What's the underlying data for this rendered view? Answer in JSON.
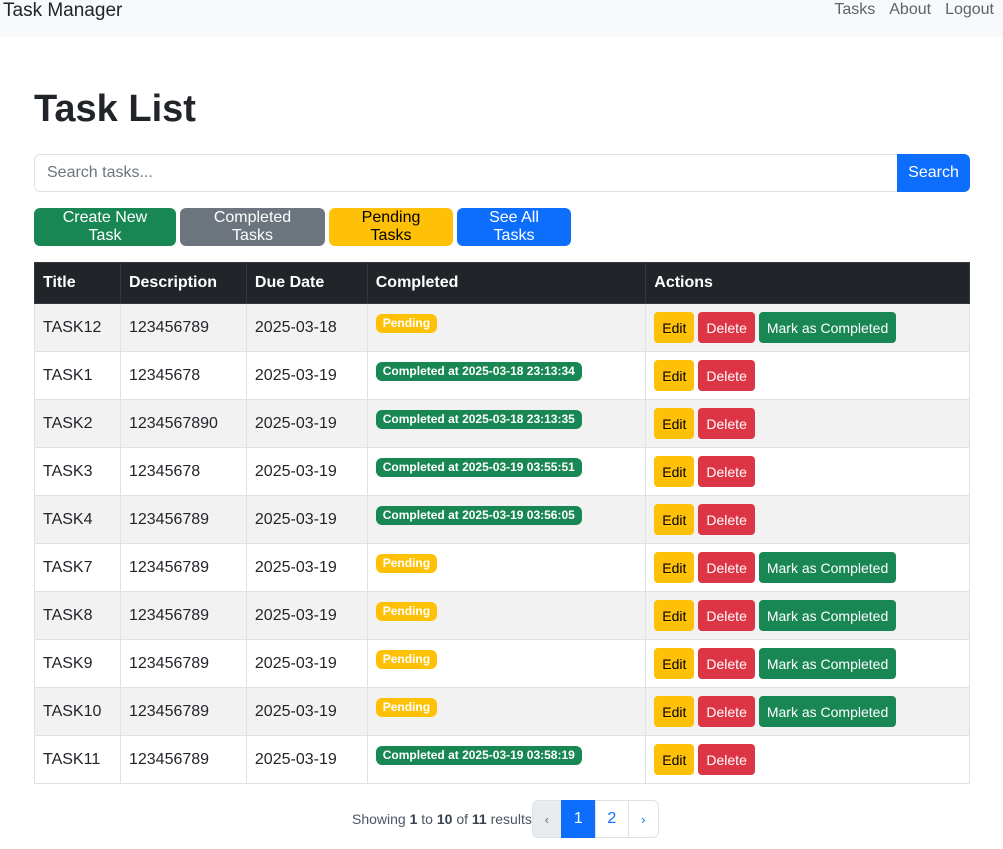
{
  "navbar": {
    "brand": "Task Manager",
    "links": [
      "Tasks",
      "About",
      "Logout"
    ]
  },
  "page": {
    "title": "Task List"
  },
  "search": {
    "placeholder": "Search tasks...",
    "button": "Search"
  },
  "filters": {
    "create": "Create New Task",
    "completed": "Completed Tasks",
    "pending": "Pending Tasks",
    "all": "See All Tasks"
  },
  "table": {
    "headers": [
      "Title",
      "Description",
      "Due Date",
      "Completed",
      "Actions"
    ],
    "rows": [
      {
        "title": "TASK12",
        "description": "123456789",
        "due": "2025-03-18",
        "status": "Pending",
        "completed": false
      },
      {
        "title": "TASK1",
        "description": "12345678",
        "due": "2025-03-19",
        "status": "Completed at 2025-03-18 23:13:34",
        "completed": true
      },
      {
        "title": "TASK2",
        "description": "1234567890",
        "due": "2025-03-19",
        "status": "Completed at 2025-03-18 23:13:35",
        "completed": true
      },
      {
        "title": "TASK3",
        "description": "12345678",
        "due": "2025-03-19",
        "status": "Completed at 2025-03-19 03:55:51",
        "completed": true
      },
      {
        "title": "TASK4",
        "description": "123456789",
        "due": "2025-03-19",
        "status": "Completed at 2025-03-19 03:56:05",
        "completed": true
      },
      {
        "title": "TASK7",
        "description": "123456789",
        "due": "2025-03-19",
        "status": "Pending",
        "completed": false
      },
      {
        "title": "TASK8",
        "description": "123456789",
        "due": "2025-03-19",
        "status": "Pending",
        "completed": false
      },
      {
        "title": "TASK9",
        "description": "123456789",
        "due": "2025-03-19",
        "status": "Pending",
        "completed": false
      },
      {
        "title": "TASK10",
        "description": "123456789",
        "due": "2025-03-19",
        "status": "Pending",
        "completed": false
      },
      {
        "title": "TASK11",
        "description": "123456789",
        "due": "2025-03-19",
        "status": "Completed at 2025-03-19 03:58:19",
        "completed": true
      }
    ],
    "actions": {
      "edit": "Edit",
      "delete": "Delete",
      "mark": "Mark as Completed"
    }
  },
  "pagination": {
    "showing_prefix": "Showing",
    "from": "1",
    "to_word": "to",
    "to": "10",
    "of_word": "of",
    "total": "11",
    "results_word": "results",
    "prev": "‹",
    "pages": [
      "1",
      "2"
    ],
    "current": "1",
    "next": "›"
  },
  "colors": {
    "primary": "#0d6efd",
    "success": "#198754",
    "warning": "#ffc107",
    "danger": "#dc3545",
    "secondary": "#6c757d",
    "dark": "#212529"
  }
}
